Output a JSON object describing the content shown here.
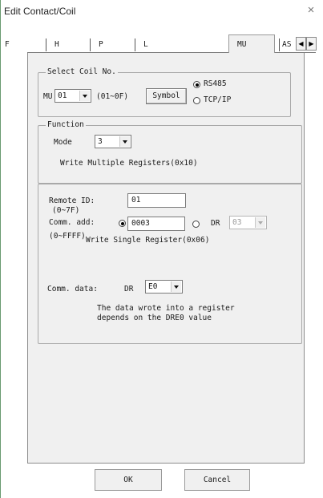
{
  "window": {
    "title": "Edit Contact/Coil",
    "close_glyph": "×"
  },
  "tabs": {
    "items": [
      "F",
      "H",
      "P",
      "L",
      "MU",
      "AS"
    ],
    "active": "MU",
    "scroll_left": "◀",
    "scroll_right": "▶"
  },
  "select_coil": {
    "legend": "Select Coil No.",
    "prefix": "MU",
    "coil_value": "01",
    "range": "(01~0F)",
    "symbol_button": "Symbol",
    "radio_rs485": "RS485",
    "radio_tcpip": "TCP/IP",
    "selected": "RS485"
  },
  "function": {
    "legend": "Function",
    "mode_label": "Mode",
    "mode_value": "3",
    "description": "Write Multiple Registers(0x10)"
  },
  "params": {
    "remote_id_label": "Remote ID:",
    "remote_id_range": "(0~7F)",
    "remote_id_value": "01",
    "comm_add_label": "Comm. add:",
    "comm_add_value": "0003",
    "comm_add_range": "(0~FFFF)",
    "dr_label": "DR",
    "dr_value": "03",
    "single_register_text": "Write Single Register(0x06)",
    "comm_data_label": "Comm. data:",
    "comm_data_prefix": "DR",
    "comm_data_value": "E0",
    "note_line1": "The data wrote into a register",
    "note_line2": "depends on the DRE0 value"
  },
  "buttons": {
    "ok": "OK",
    "cancel": "Cancel"
  }
}
